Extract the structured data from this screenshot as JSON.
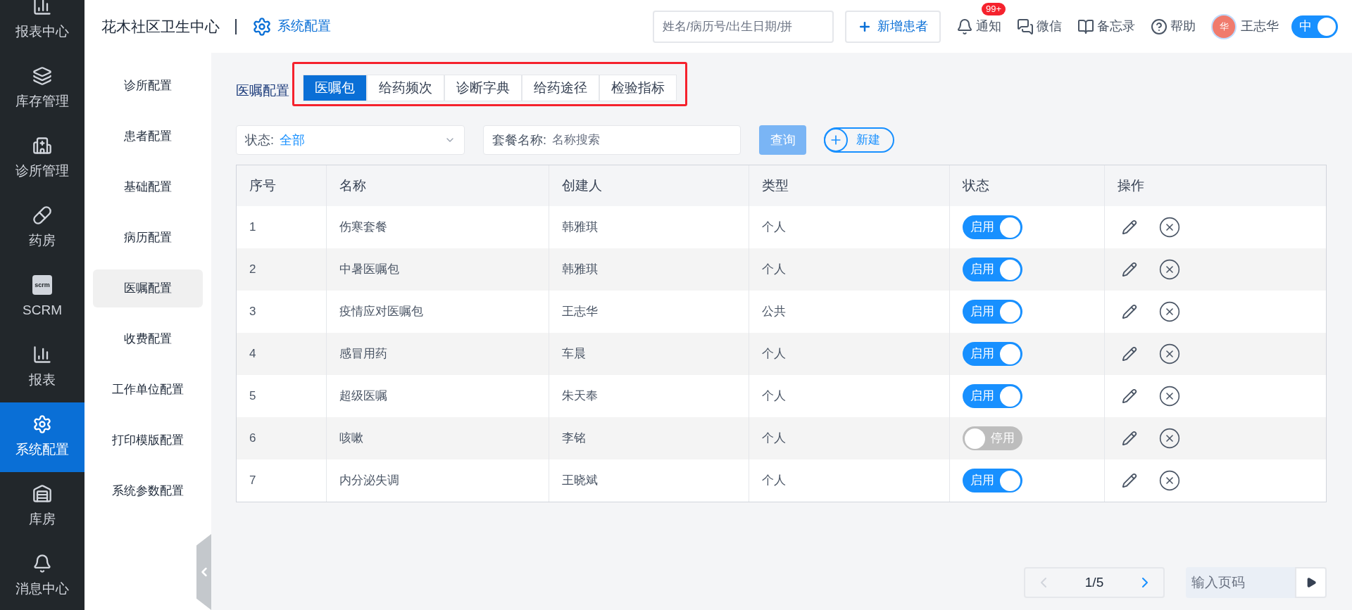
{
  "nav": [
    {
      "label": "报表中心",
      "kind": "chart",
      "selected": false
    },
    {
      "label": "库存管理",
      "kind": "layers",
      "selected": false
    },
    {
      "label": "诊所管理",
      "kind": "clinic",
      "selected": false
    },
    {
      "label": "药房",
      "kind": "pill",
      "selected": false
    },
    {
      "label": "SCRM",
      "kind": "scrm",
      "icon_text": "scrm",
      "selected": false
    },
    {
      "label": "报表",
      "kind": "chart",
      "selected": false
    },
    {
      "label": "系统配置",
      "kind": "gear",
      "selected": true
    },
    {
      "label": "库房",
      "kind": "warehouse",
      "selected": false
    },
    {
      "label": "消息中心",
      "kind": "bell",
      "selected": false
    }
  ],
  "header": {
    "clinic": "花木社区卫生中心",
    "module": "系统配置",
    "search": {
      "placeholder": "姓名/病历号/出生日期/拼"
    },
    "add_button": "新增患者",
    "actions": [
      {
        "label": "通知",
        "kind": "bell",
        "badge": "99+"
      },
      {
        "label": "微信",
        "kind": "wechat"
      },
      {
        "label": "备忘录",
        "kind": "book"
      },
      {
        "label": "帮助",
        "kind": "help"
      }
    ],
    "user": {
      "avatar": "华",
      "name": "王志华"
    },
    "lang_toggle": {
      "label": "中",
      "on": true
    }
  },
  "sub_menu": [
    {
      "label": "诊所配置",
      "selected": false
    },
    {
      "label": "患者配置",
      "selected": false
    },
    {
      "label": "基础配置",
      "selected": false
    },
    {
      "label": "病历配置",
      "selected": false
    },
    {
      "label": "医嘱配置",
      "selected": true
    },
    {
      "label": "收费配置",
      "selected": false
    },
    {
      "label": "工作单位配置",
      "selected": false
    },
    {
      "label": "打印模版配置",
      "selected": false
    },
    {
      "label": "系统参数配置",
      "selected": false
    }
  ],
  "section_label": "医嘱配置",
  "tabs": [
    {
      "label": "医嘱包",
      "selected": true
    },
    {
      "label": "给药频次",
      "selected": false
    },
    {
      "label": "诊断字典",
      "selected": false
    },
    {
      "label": "给药途径",
      "selected": false
    },
    {
      "label": "检验指标",
      "selected": false
    }
  ],
  "filters": {
    "status": {
      "label": "状态:",
      "value": "全部"
    },
    "name": {
      "label": "套餐名称:",
      "placeholder": "名称搜索"
    },
    "query_button": "查询",
    "new_button": "新建"
  },
  "table": {
    "columns": [
      "序号",
      "名称",
      "创建人",
      "类型",
      "状态",
      "操作"
    ],
    "rows": [
      {
        "no": "1",
        "name": "伤寒套餐",
        "creator": "韩雅琪",
        "type": "个人",
        "status": {
          "on": true,
          "label": "启用"
        }
      },
      {
        "no": "2",
        "name": "中暑医嘱包",
        "creator": "韩雅琪",
        "type": "个人",
        "status": {
          "on": true,
          "label": "启用"
        }
      },
      {
        "no": "3",
        "name": "疫情应对医嘱包",
        "creator": "王志华",
        "type": "公共",
        "status": {
          "on": true,
          "label": "启用"
        }
      },
      {
        "no": "4",
        "name": "感冒用药",
        "creator": "车晨",
        "type": "个人",
        "status": {
          "on": true,
          "label": "启用"
        }
      },
      {
        "no": "5",
        "name": "超级医嘱",
        "creator": "朱天奉",
        "type": "个人",
        "status": {
          "on": true,
          "label": "启用"
        }
      },
      {
        "no": "6",
        "name": "咳嗽",
        "creator": "李铭",
        "type": "个人",
        "status": {
          "on": false,
          "label": "停用"
        }
      },
      {
        "no": "7",
        "name": "内分泌失调",
        "creator": "王晓斌",
        "type": "个人",
        "status": {
          "on": true,
          "label": "启用"
        }
      }
    ]
  },
  "pagination": {
    "page": "1/5",
    "jump": {
      "placeholder": "输入页码"
    }
  }
}
